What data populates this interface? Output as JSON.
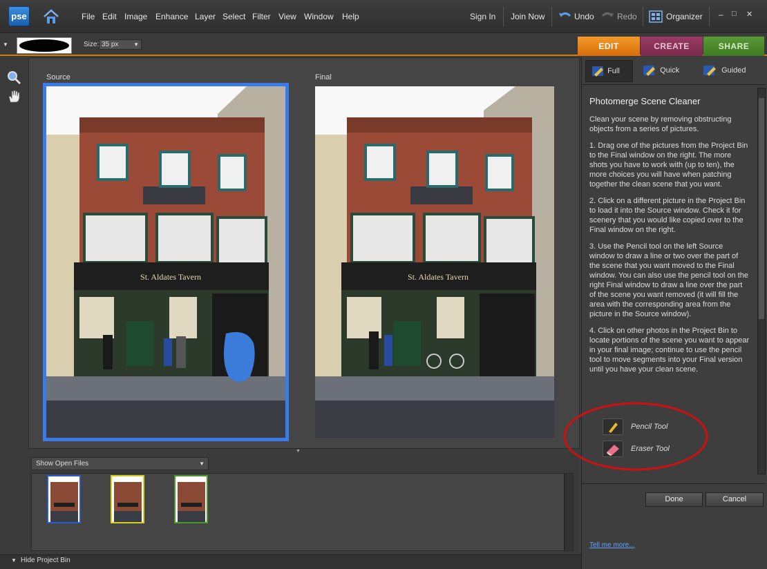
{
  "app": {
    "logo": "pse",
    "icon_home": "home-icon"
  },
  "menu": [
    "File",
    "Edit",
    "Image",
    "Enhance",
    "Layer",
    "Select",
    "Filter",
    "View",
    "Window",
    "Help"
  ],
  "topbar": {
    "sign_in": "Sign In",
    "join_now": "Join Now",
    "undo": "Undo",
    "redo": "Redo",
    "organizer": "Organizer",
    "min": "–",
    "max": "□",
    "close": "✕"
  },
  "options": {
    "size_label": "Size:",
    "size_value": "35 px"
  },
  "modes": {
    "edit": "EDIT",
    "create": "CREATE",
    "share": "SHARE"
  },
  "subtabs": {
    "full": "Full",
    "quick": "Quick",
    "guided": "Guided"
  },
  "panels": {
    "source": "Source",
    "final": "Final"
  },
  "photo": {
    "sign": "St. Aldates Tavern"
  },
  "guide": {
    "title": "Photomerge Scene Cleaner",
    "intro": "Clean your scene by removing obstructing objects from a series of pictures.",
    "step1": "1. Drag one of the pictures from the Project Bin to the Final window on the right. The more shots you have to work with (up to ten), the more choices you will have when patching together the clean scene that you want.",
    "step2": "2. Click on a different picture in the Project Bin to load it into the Source window. Check it for scenery that you would like copied over to the Final window on the right.",
    "step3": "3. Use the Pencil tool on the left Source window to draw a line or two over the part of the scene that you want moved to the Final window. You can also use the pencil tool on the right Final window to draw a line over the part of the scene you want removed (it will fill the area with the corresponding area from the picture in the Source window).",
    "step4": "4. Click on other photos in the Project Bin to locate portions of the scene you want to appear in your final image; continue to use the pencil tool to move segments into your Final version until you have your clean scene.",
    "pencil": "Pencil Tool",
    "eraser": "Eraser Tool"
  },
  "buttons": {
    "done": "Done",
    "cancel": "Cancel"
  },
  "tell_more": "Tell me more...",
  "bin": {
    "show": "Show Open Files",
    "hide": "Hide Project Bin"
  },
  "colors": {
    "accent_edit": "#e07a10",
    "create": "#a0305e",
    "share": "#4c8c2c",
    "selection": "#3a7bea"
  }
}
